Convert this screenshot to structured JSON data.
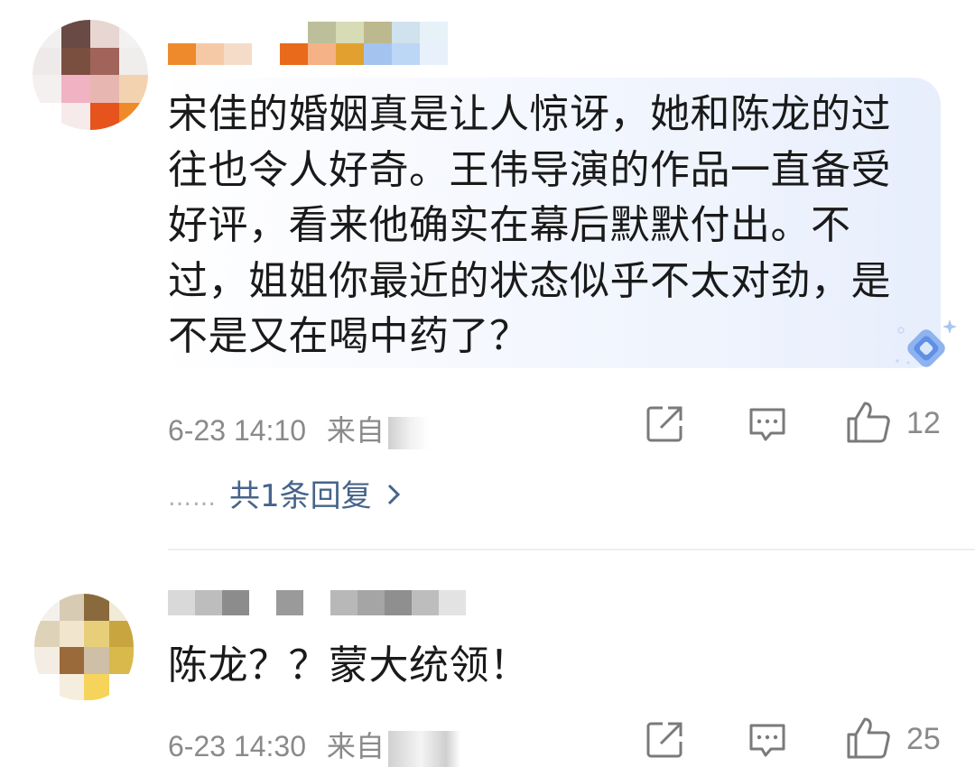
{
  "comments": [
    {
      "text": "宋佳的婚姻真是让人惊讶，她和陈龙的过往也令人好奇。王伟导演的作品一直备受好评，看来他确实在幕后默默付出。不过，姐姐你最近的状态似乎不太对劲，是不是又在喝中药了？",
      "time": "6-23 14:10",
      "source_prefix": "来自",
      "share_icon": "share-icon",
      "comment_icon": "comment-icon",
      "like_icon": "like-icon",
      "like_count": "12",
      "replies_label": "共1条回复",
      "replies_dots": "……",
      "replies_chevron": "chevron-right-icon"
    },
    {
      "text": "陈龙？？蒙大统领！",
      "time": "6-23 14:30",
      "source_prefix": "来自",
      "share_icon": "share-icon",
      "comment_icon": "comment-icon",
      "like_icon": "like-icon",
      "like_count": "25"
    }
  ],
  "colors": {
    "text": "#1a1a1a",
    "meta": "#8a8a8a",
    "link": "#46648a",
    "bubble": "#eef3fd"
  }
}
